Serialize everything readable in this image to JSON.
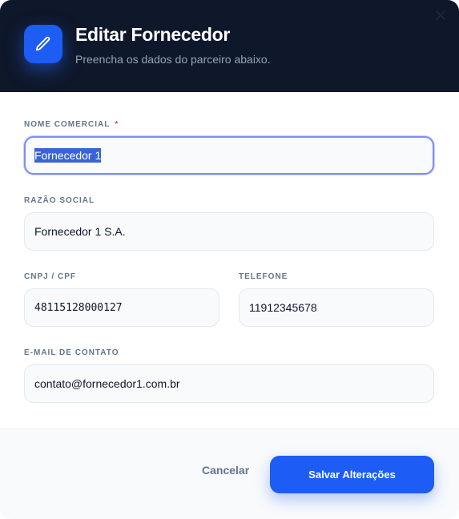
{
  "header": {
    "title": "Editar Fornecedor",
    "subtitle": "Preencha os dados do parceiro abaixo.",
    "icon": "pencil-icon",
    "close_icon": "close-icon",
    "accent_color": "#1d5cf5",
    "background_color": "#0f172a"
  },
  "form": {
    "nome_comercial": {
      "label": "NOME COMERCIAL",
      "required_mark": "*",
      "value": "Fornecedor 1"
    },
    "razao_social": {
      "label": "RAZÃO SOCIAL",
      "value": "Fornecedor 1 S.A."
    },
    "cnpj_cpf": {
      "label": "CNPJ / CPF",
      "value": "48115128000127"
    },
    "telefone": {
      "label": "TELEFONE",
      "value": "11912345678"
    },
    "email": {
      "label": "E-MAIL DE CONTATO",
      "value": "contato@fornecedor1.com.br"
    }
  },
  "footer": {
    "cancel_label": "Cancelar",
    "save_label": "Salvar Alterações"
  }
}
